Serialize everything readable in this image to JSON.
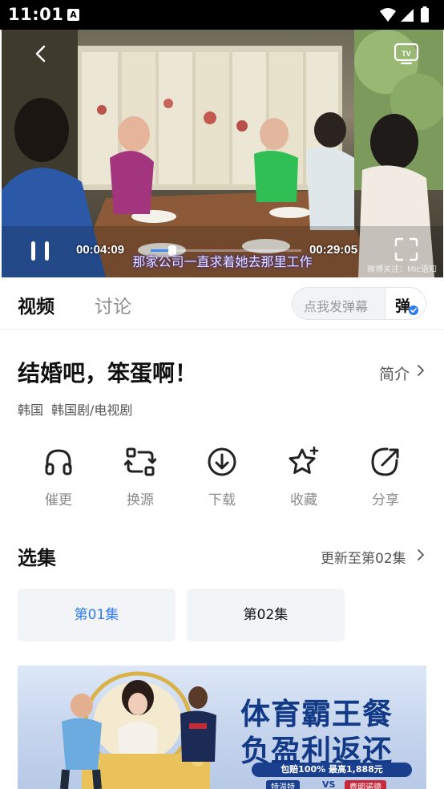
{
  "status_bar": {
    "time": "11:01",
    "notification_icon": "A"
  },
  "player": {
    "current_time": "00:04:09",
    "total_time": "00:29:05",
    "progress_fraction": 0.143,
    "subtitle": "那家公司一直求着她去那里工作",
    "watermark": "微博关注：Mic语知",
    "icons": [
      "back-chevron-icon",
      "tv-cast-icon",
      "pause-icon",
      "fullscreen-icon"
    ]
  },
  "tabs": {
    "video": "视频",
    "discussion": "讨论"
  },
  "danmu": {
    "placeholder": "点我发弹幕",
    "toggle_label": "弹"
  },
  "show": {
    "title": "结婚吧，笨蛋啊！",
    "intro_label": "简介",
    "country": "韩国",
    "genre": "韩国剧/电视剧"
  },
  "actions": [
    {
      "label": "催更",
      "icon": "headphones-icon"
    },
    {
      "label": "换源",
      "icon": "switch-source-icon"
    },
    {
      "label": "下载",
      "icon": "download-icon"
    },
    {
      "label": "收藏",
      "icon": "star-icon"
    },
    {
      "label": "分享",
      "icon": "share-icon"
    }
  ],
  "episodes": {
    "title": "选集",
    "update_label": "更新至第02集",
    "items": [
      {
        "label": "第01集",
        "selected": true
      },
      {
        "label": "第02集",
        "selected": false
      }
    ]
  },
  "ad": {
    "headline_line1": "体育霸王餐",
    "headline_line2": "负盈利返还",
    "promo": "包赔100% 最高1,888元",
    "team1": "特温特",
    "vs": "VS",
    "team2": "费耶诺德"
  },
  "colors": {
    "accent": "#2f7bf0",
    "ad_navy": "#123a86"
  }
}
